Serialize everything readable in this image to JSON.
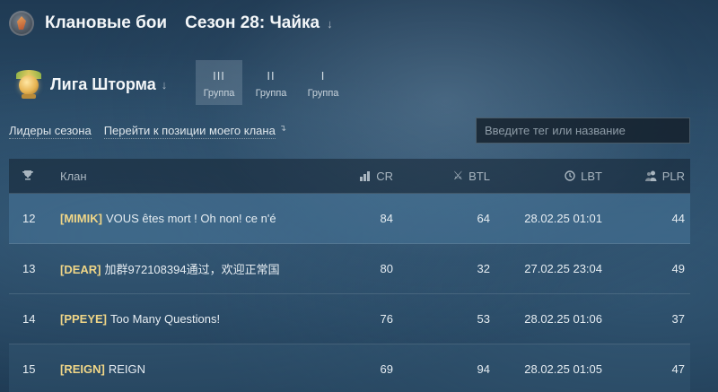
{
  "header": {
    "title": "Клановые бои",
    "season": "Сезон 28: Чайка",
    "season_arrow": "↓"
  },
  "league": {
    "name": "Лига Шторма",
    "arrow": "↓"
  },
  "groups": [
    {
      "roman": "III",
      "label": "Группа",
      "active": true
    },
    {
      "roman": "II",
      "label": "Группа",
      "active": false
    },
    {
      "roman": "I",
      "label": "Группа",
      "active": false
    }
  ],
  "links": {
    "leaders": "Лидеры сезона",
    "goto": "Перейти к позиции моего клана",
    "goto_icon": "↴"
  },
  "search": {
    "placeholder": "Введите тег или название"
  },
  "table": {
    "headers": {
      "rank_icon": "trophy-icon",
      "clan": "Клан",
      "cr": "CR",
      "btl": "BTL",
      "lbt": "LBT",
      "plr": "PLR"
    },
    "rows": [
      {
        "rank": "12",
        "tag": "[MIMIK]",
        "name": "VOUS êtes mort ! Oh non! ce n'é",
        "cr": "84",
        "btl": "64",
        "lbt": "28.02.25 01:01",
        "plr": "44"
      },
      {
        "rank": "13",
        "tag": "[DEAR]",
        "name": "加群972108394通过，欢迎正常国",
        "cr": "80",
        "btl": "32",
        "lbt": "27.02.25 23:04",
        "plr": "49"
      },
      {
        "rank": "14",
        "tag": "[PPEYE]",
        "name": "Too Many Questions!",
        "cr": "76",
        "btl": "53",
        "lbt": "28.02.25 01:06",
        "plr": "37"
      },
      {
        "rank": "15",
        "tag": "[REIGN]",
        "name": "REIGN",
        "cr": "69",
        "btl": "94",
        "lbt": "28.02.25 01:05",
        "plr": "47"
      }
    ]
  },
  "colors": {
    "tag": "#f0d687",
    "row_highlight": "#46739a",
    "accent_gold": "#e7b452"
  }
}
